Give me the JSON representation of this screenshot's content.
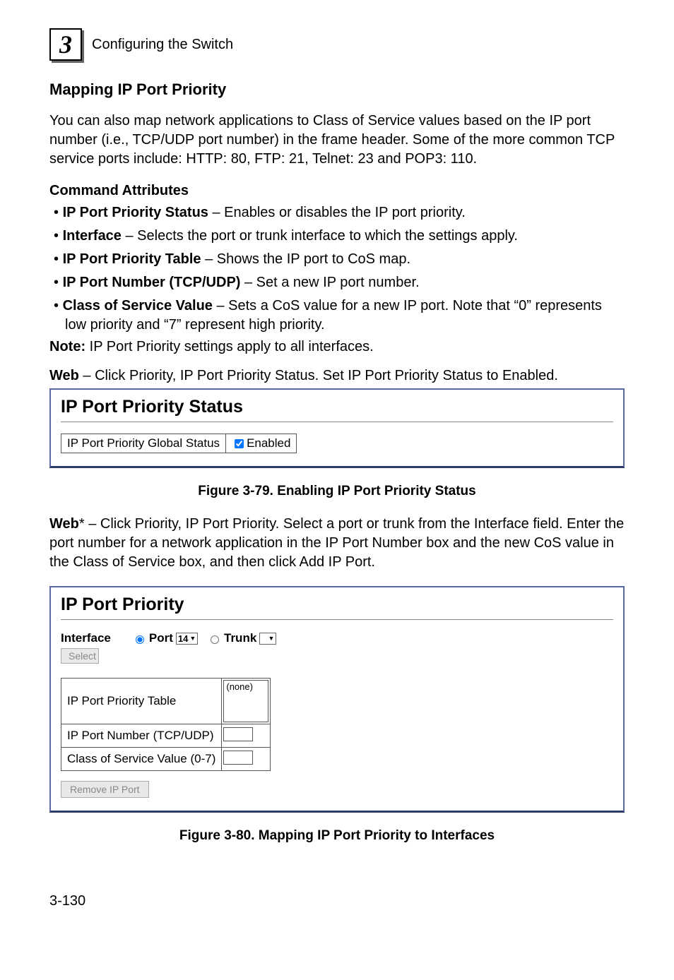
{
  "header": {
    "chapter_number": "3",
    "title": "Configuring the Switch"
  },
  "section_title": "Mapping IP Port Priority",
  "intro": "You can also map network applications to Class of Service values based on the IP port number (i.e., TCP/UDP port number) in the frame header. Some of the more common TCP service ports include: HTTP: 80, FTP: 21, Telnet: 23 and POP3: 110.",
  "cmd_attr_heading": "Command Attributes",
  "attributes": [
    {
      "name": "IP Port Priority Status",
      "desc": " – Enables or disables the IP port priority."
    },
    {
      "name": "Interface",
      "desc": " – Selects the port or trunk interface to which the settings apply."
    },
    {
      "name": "IP Port Priority Table",
      "desc": " – Shows the IP port to CoS map."
    },
    {
      "name": "IP Port Number (TCP/UDP)",
      "desc": " – Set a new IP port number."
    },
    {
      "name": "Class of Service Value",
      "desc": " – Sets a CoS value for a new IP port. Note that “0” represents low priority and “7” represent high priority."
    }
  ],
  "note": {
    "label": "Note:",
    "text": "  IP Port Priority settings apply to all interfaces."
  },
  "web1": {
    "label": "Web",
    "text": " – Click Priority, IP Port Priority Status. Set IP Port Priority Status to Enabled."
  },
  "panel1": {
    "title": "IP Port Priority Status",
    "row_label": "IP Port Priority Global Status",
    "checkbox_label": "Enabled",
    "checked": true
  },
  "figure79": "Figure 3-79.  Enabling IP Port Priority Status",
  "web2": {
    "label": "Web",
    "star": "*",
    "text": " – Click Priority, IP Port Priority. Select a port or trunk from the Interface field. Enter the port number for a network application in the IP Port Number box and the new CoS value in the Class of Service box, and then click Add IP Port."
  },
  "panel2": {
    "title": "IP Port Priority",
    "interface_label": "Interface",
    "select_button": "Select",
    "port_label": "Port",
    "port_value": "14",
    "trunk_label": "Trunk",
    "trunk_value": "",
    "table_rows": {
      "priority_table_label": "IP Port Priority Table",
      "priority_table_value": "(none)",
      "ip_port_number_label": "IP Port Number (TCP/UDP)",
      "cos_value_label": "Class of Service Value (0-7)"
    },
    "remove_button": "Remove IP Port"
  },
  "figure80": "Figure 3-80.  Mapping IP Port Priority to Interfaces",
  "page_number": "3-130"
}
